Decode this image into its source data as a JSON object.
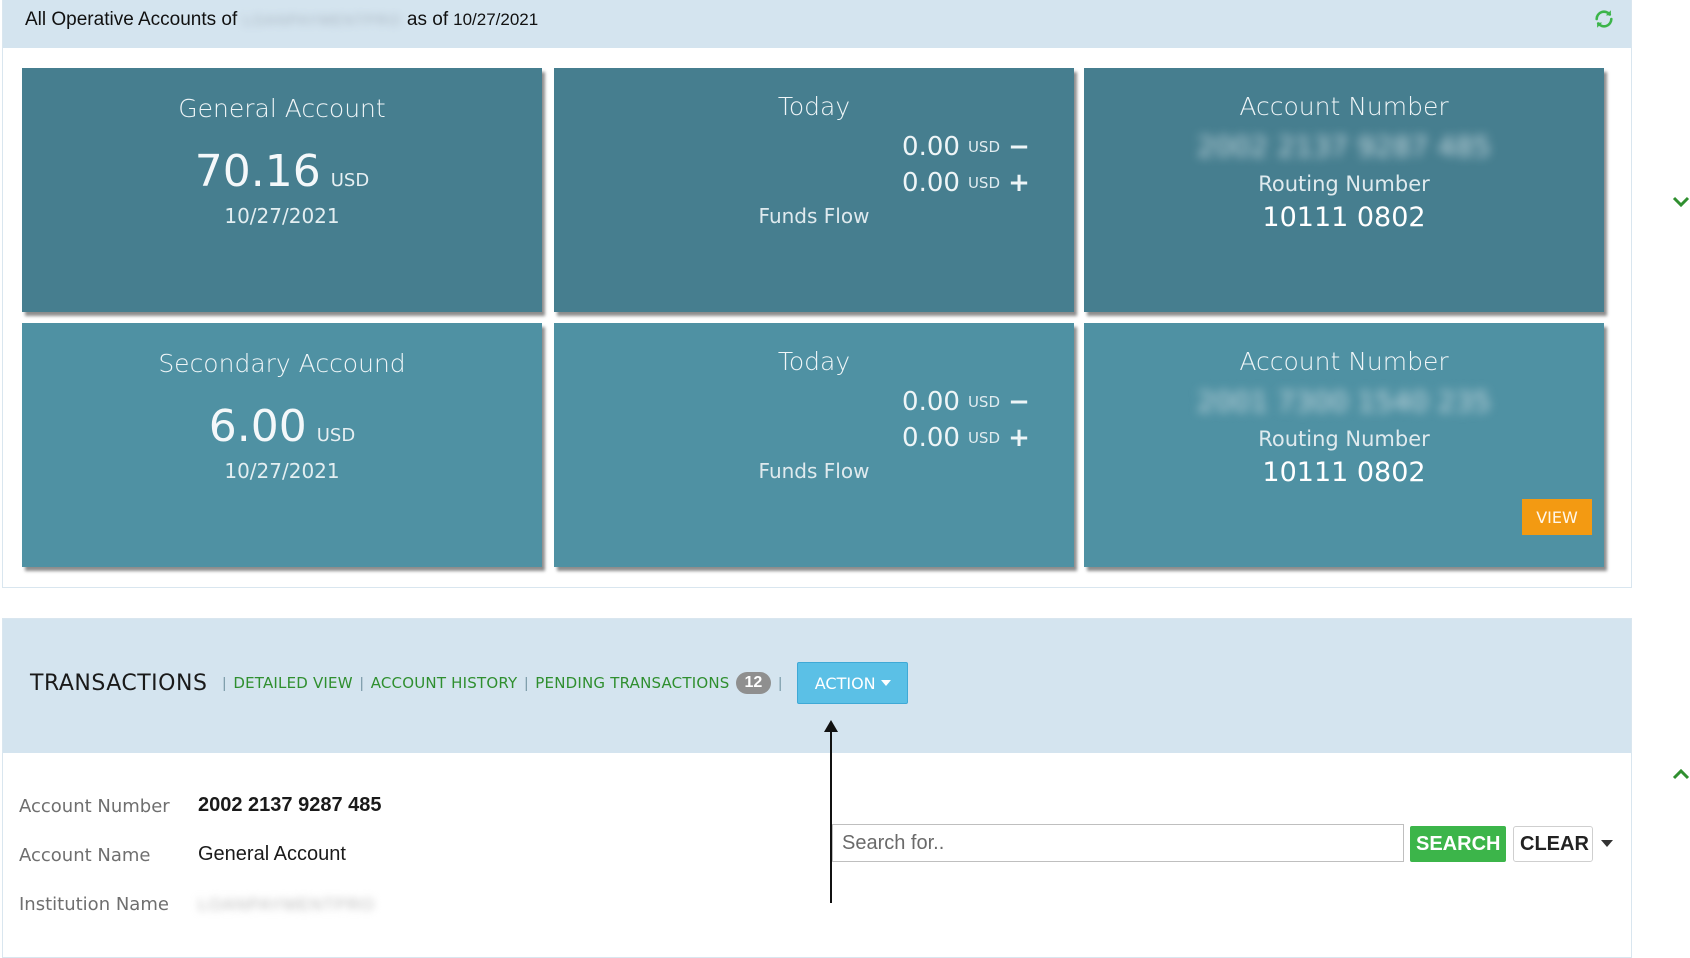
{
  "header": {
    "title_prefix": "All Operative Accounts of",
    "title_blurred": "LOANPAYMENTPRO",
    "title_suffix": "as of",
    "date": "10/27/2021"
  },
  "cards": [
    {
      "account": {
        "title": "General Account",
        "amount": "70.16",
        "currency": "USD",
        "date": "10/27/2021"
      },
      "flow": {
        "title": "Today",
        "out_amount": "0.00",
        "out_currency": "USD",
        "out_symbol": "−",
        "in_amount": "0.00",
        "in_currency": "USD",
        "in_symbol": "+",
        "label": "Funds Flow"
      },
      "info": {
        "account_label": "Account Number",
        "account_number": "2002 2137 9287 485",
        "routing_label": "Routing Number",
        "routing_number": "10111 0802"
      }
    },
    {
      "account": {
        "title": "Secondary Accound",
        "amount": "6.00",
        "currency": "USD",
        "date": "10/27/2021"
      },
      "flow": {
        "title": "Today",
        "out_amount": "0.00",
        "out_currency": "USD",
        "out_symbol": "−",
        "in_amount": "0.00",
        "in_currency": "USD",
        "in_symbol": "+",
        "label": "Funds Flow"
      },
      "info": {
        "account_label": "Account Number",
        "account_number": "2001 7300 1540 235",
        "routing_label": "Routing Number",
        "routing_number": "10111 0802",
        "view_label": "VIEW"
      }
    }
  ],
  "transactions": {
    "title": "TRANSACTIONS",
    "separator": "|",
    "links": {
      "detailed_view": "DETAILED VIEW",
      "account_history": "ACCOUNT HISTORY",
      "pending_transactions": "PENDING TRANSACTIONS"
    },
    "pending_count": "12",
    "action_label": "ACTION"
  },
  "details": {
    "account_number_label": "Account Number",
    "account_number": "2002 2137 9287 485",
    "account_name_label": "Account Name",
    "account_name": "General Account",
    "institution_name_label": "Institution Name",
    "institution_name_blurred": "LOANPAYMENTPRO"
  },
  "search": {
    "placeholder": "Search for..",
    "search_label": "SEARCH",
    "clear_label": "CLEAR"
  },
  "colors": {
    "card_dark": "#467e8f",
    "card_light": "#4f91a3",
    "header_bg": "#d4e4ef",
    "link_green": "#2f8f2f",
    "view_orange": "#f39a12",
    "action_blue": "#5bc0e6",
    "search_green": "#3cb54a"
  }
}
